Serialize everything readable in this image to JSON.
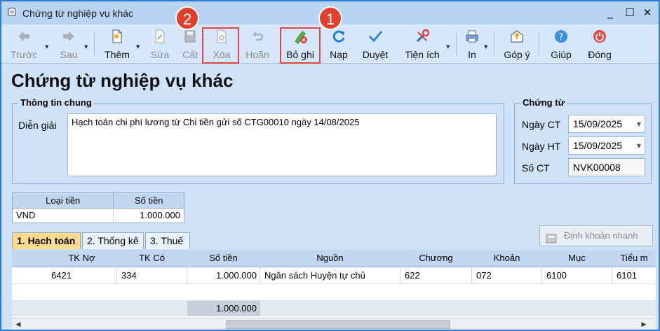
{
  "window": {
    "title": "Chứng từ nghiệp vụ khác",
    "controls": [
      "_",
      "☐",
      "✕"
    ]
  },
  "toolbar": {
    "buttons": [
      {
        "label": "Trước",
        "icon": "arrow-left-icon",
        "enabled": false
      },
      {
        "label": "Sau",
        "icon": "arrow-right-icon",
        "enabled": false
      },
      {
        "label": "Thêm",
        "icon": "new-document-icon",
        "enabled": true
      },
      {
        "label": "Sửa",
        "icon": "edit-document-icon",
        "enabled": false
      },
      {
        "label": "Cất",
        "icon": "save-icon",
        "enabled": false
      },
      {
        "label": "Xóa",
        "icon": "delete-document-icon",
        "enabled": false
      },
      {
        "label": "Hoãn",
        "icon": "undo-icon",
        "enabled": false
      },
      {
        "label": "Bỏ ghi",
        "icon": "unpost-pen-icon",
        "enabled": true
      },
      {
        "label": "Nạp",
        "icon": "refresh-icon",
        "enabled": true
      },
      {
        "label": "Duyệt",
        "icon": "checkmark-icon",
        "enabled": true
      },
      {
        "label": "Tiện ích",
        "icon": "tools-icon",
        "enabled": true
      },
      {
        "label": "In",
        "icon": "printer-icon",
        "enabled": true
      },
      {
        "label": "Góp ý",
        "icon": "feedback-icon",
        "enabled": true
      },
      {
        "label": "Giúp",
        "icon": "help-icon",
        "enabled": true
      },
      {
        "label": "Đóng",
        "icon": "power-icon",
        "enabled": true
      }
    ]
  },
  "annotations": {
    "badge_1": "1",
    "badge_2": "2"
  },
  "page_title": "Chứng từ nghiệp vụ khác",
  "general_info": {
    "legend": "Thông tin chung",
    "description_label": "Diễn giải",
    "description_value": "Hạch toán chi phí lương từ Chi tiền gửi số CTG00010 ngày 14/08/2025"
  },
  "voucher": {
    "legend": "Chứng từ",
    "date_ct_label": "Ngày CT",
    "date_ct_value": "15/09/2025",
    "date_ht_label": "Ngày HT",
    "date_ht_value": "15/09/2025",
    "number_label": "Số CT",
    "number_value": "NVK00008"
  },
  "currency_table": {
    "headers": [
      "Loại tiền",
      "Số tiền"
    ],
    "row": {
      "currency": "VND",
      "amount": "1.000.000"
    }
  },
  "tabs": [
    {
      "label": "1. Hạch toán",
      "active": true
    },
    {
      "label": "2. Thống kê",
      "active": false
    },
    {
      "label": "3. Thuế",
      "active": false
    }
  ],
  "quick_entry_button": "Định khoản nhanh",
  "grid": {
    "headers": [
      "TK Nợ",
      "TK Có",
      "Số tiền",
      "Nguồn",
      "Chương",
      "Khoản",
      "Mục",
      "Tiểu m"
    ],
    "rows": [
      [
        "6421",
        "334",
        "1.000.000",
        "Ngân sách Huyện tự chủ",
        "622",
        "072",
        "6100",
        "6101"
      ]
    ],
    "total": "1.000.000"
  },
  "colors": {
    "accent": "#2d7bd8",
    "highlight_box": "#e24545",
    "badge": "#e0412d",
    "active_tab": "#ffd98c"
  }
}
